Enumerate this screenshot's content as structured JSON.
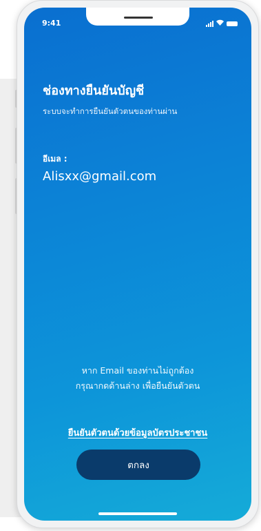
{
  "status_bar": {
    "time": "9:41"
  },
  "screen": {
    "title": "ช่องทางยืนยันบัญชี",
    "subtitle": "ระบบจะทำการยืนยันตัวตนของท่านผ่าน",
    "email_label": "อีเมล :",
    "email_value": "Alisxx@gmail.com",
    "help_line1": "หาก Email ของท่านไม่ถูกต้อง",
    "help_line2": "กรุณากดด้านล่าง เพื่อยืนยันตัวตน",
    "verify_link": "ยืนยันตัวตนด้วยข้อมูลบัตรประชาชน",
    "ok_button": "ตกลง"
  },
  "colors": {
    "gradient_top": "#0a6fd0",
    "gradient_bottom": "#15abd8",
    "button": "#0a3b6b"
  },
  "icons": [
    "signal-icon",
    "wifi-icon",
    "battery-icon"
  ]
}
